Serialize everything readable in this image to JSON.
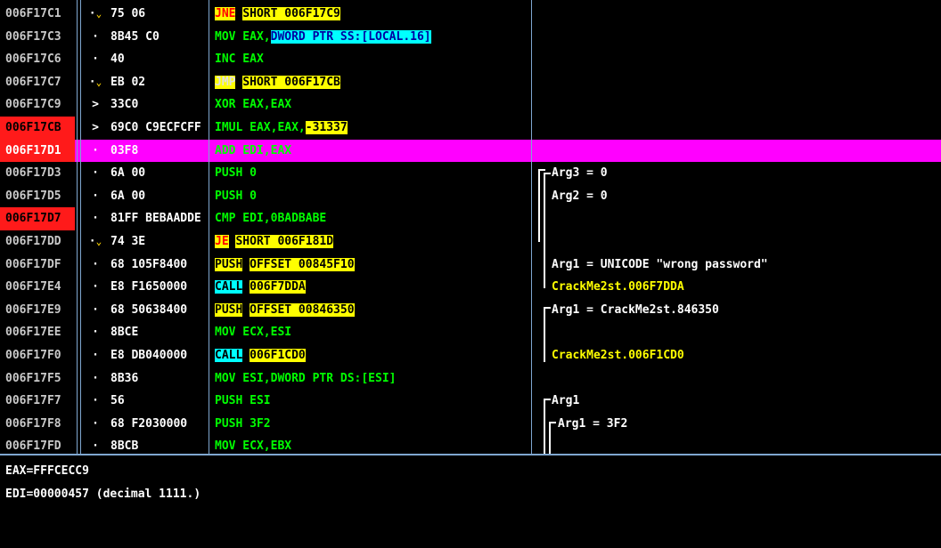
{
  "colors": {
    "background": "#000000",
    "highlight_row": "#ff00ff",
    "breakpoint": "#ff1a1a",
    "jump_highlight": "#ffff00",
    "call_highlight": "#00ffff",
    "instruction_text": "#00ff00",
    "comment_text": "#ffffff"
  },
  "rows": [
    {
      "addr": "006F17C1",
      "mark": "·",
      "jump": "v",
      "hex": "75 06",
      "i": [
        "JNE",
        " ",
        "SHORT 006F17C9"
      ],
      "comment": ""
    },
    {
      "addr": "006F17C3",
      "mark": "·",
      "hex": "8B45 C0",
      "i": [
        "MOV EAX,",
        "DWORD PTR SS:[LOCAL.16]"
      ],
      "comment": ""
    },
    {
      "addr": "006F17C6",
      "mark": "·",
      "hex": "40",
      "i": [
        "INC EAX"
      ],
      "comment": ""
    },
    {
      "addr": "006F17C7",
      "mark": "·",
      "jump": "v",
      "hex": "EB 02",
      "i": [
        "JMP",
        " ",
        "SHORT 006F17CB"
      ],
      "comment": ""
    },
    {
      "addr": "006F17C9",
      "mark": ">",
      "hex": "33C0",
      "i": [
        "XOR EAX,EAX"
      ],
      "comment": ""
    },
    {
      "addr": "006F17CB",
      "mark": ">",
      "hex": "69C0 C9ECFCFF",
      "i": [
        "IMUL EAX,EAX,",
        "-31337"
      ],
      "comment": ""
    },
    {
      "addr": "006F17D1",
      "mark": "·",
      "hex": "03F8",
      "i": [
        "ADD EDI,EAX"
      ],
      "comment": ""
    },
    {
      "addr": "006F17D3",
      "mark": "·",
      "hex": "6A 00",
      "i": [
        "PUSH 0"
      ],
      "comment": "Arg3 = 0"
    },
    {
      "addr": "006F17D5",
      "mark": "·",
      "hex": "6A 00",
      "i": [
        "PUSH 0"
      ],
      "comment": "Arg2 = 0"
    },
    {
      "addr": "006F17D7",
      "mark": "·",
      "hex": "81FF BEBAADDE",
      "i": [
        "CMP EDI,0BADBABE"
      ],
      "comment": ""
    },
    {
      "addr": "006F17DD",
      "mark": "·",
      "jump": "v",
      "hex": "74 3E",
      "i": [
        "JE",
        " ",
        "SHORT 006F181D"
      ],
      "comment": ""
    },
    {
      "addr": "006F17DF",
      "mark": "·",
      "hex": "68 105F8400",
      "i": [
        "PUSH",
        " ",
        "OFFSET 00845F10"
      ],
      "comment": "Arg1 = UNICODE \"wrong password\""
    },
    {
      "addr": "006F17E4",
      "mark": "·",
      "hex": "E8 F1650000",
      "i": [
        "CALL",
        " ",
        "006F7DDA"
      ],
      "comment": "CrackMe2st.006F7DDA"
    },
    {
      "addr": "006F17E9",
      "mark": "·",
      "hex": "68 50638400",
      "i": [
        "PUSH",
        " ",
        "OFFSET 00846350"
      ],
      "comment": "Arg1 = CrackMe2st.846350"
    },
    {
      "addr": "006F17EE",
      "mark": "·",
      "hex": "8BCE",
      "i": [
        "MOV ECX,ESI"
      ],
      "comment": ""
    },
    {
      "addr": "006F17F0",
      "mark": "·",
      "hex": "E8 DB040000",
      "i": [
        "CALL",
        " ",
        "006F1CD0"
      ],
      "comment": "CrackMe2st.006F1CD0"
    },
    {
      "addr": "006F17F5",
      "mark": "·",
      "hex": "8B36",
      "i": [
        "MOV ESI,DWORD PTR DS:[ESI]"
      ],
      "comment": ""
    },
    {
      "addr": "006F17F7",
      "mark": "·",
      "hex": "56",
      "i": [
        "PUSH ESI"
      ],
      "comment": "Arg1"
    },
    {
      "addr": "006F17F8",
      "mark": "·",
      "hex": "68 F2030000",
      "i": [
        "PUSH 3F2"
      ],
      "comment": "Arg1 = 3F2"
    },
    {
      "addr": "006F17FD",
      "mark": "·",
      "hex": "8BCB",
      "i": [
        "MOV ECX,EBX"
      ],
      "comment": ""
    }
  ],
  "registers": {
    "line1": "EAX=FFFCECC9",
    "line2": "EDI=00000457 (decimal 1111.)"
  }
}
